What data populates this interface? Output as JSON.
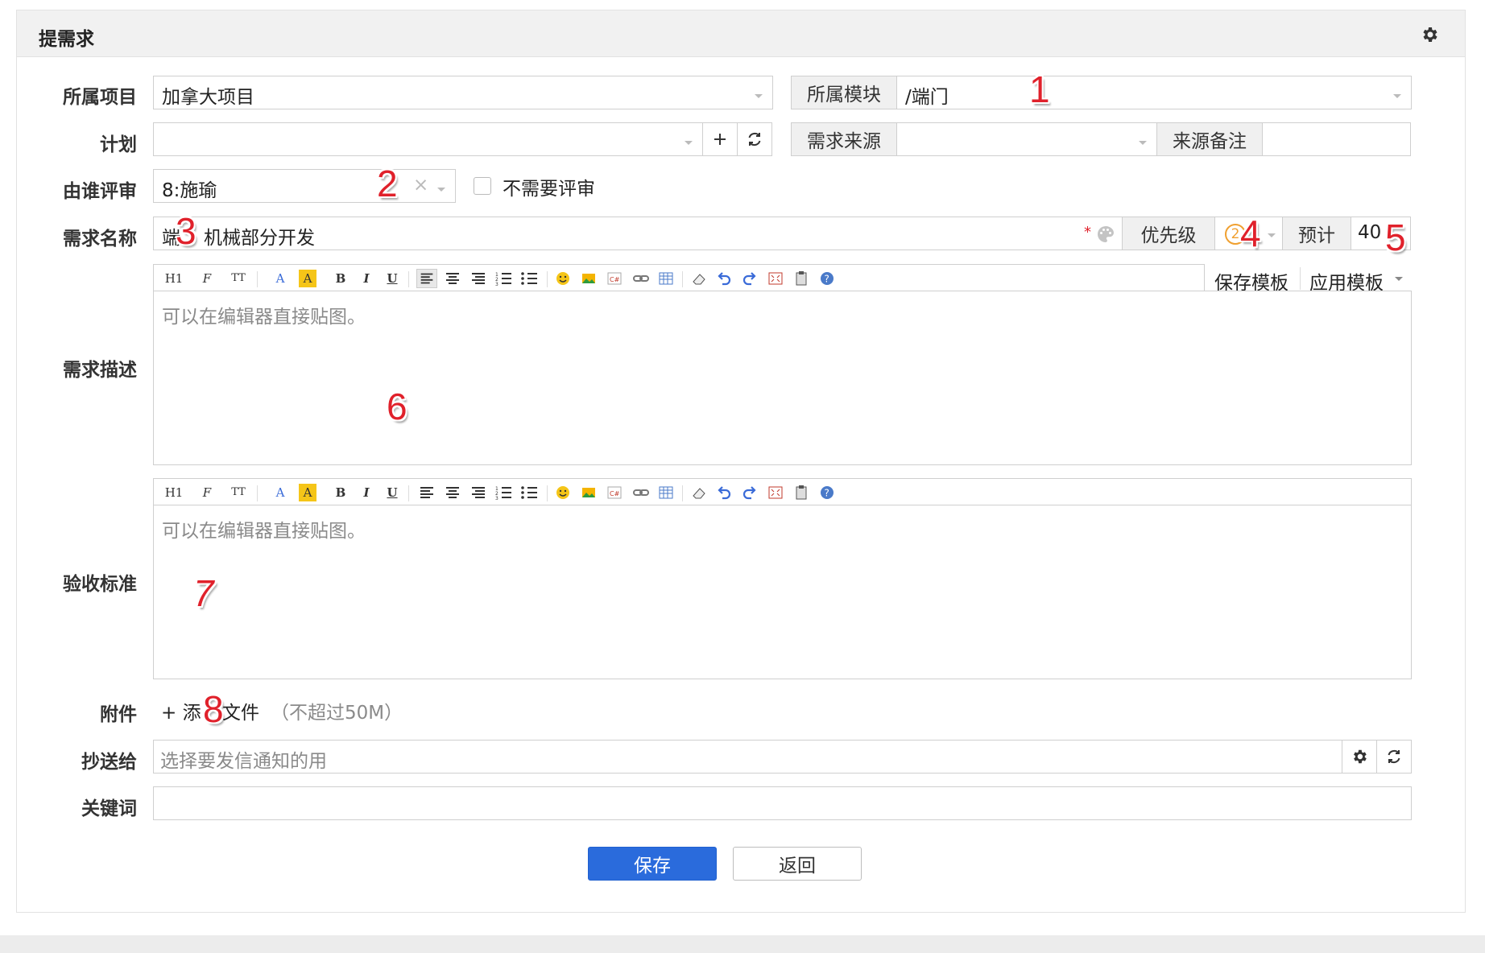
{
  "header": {
    "title": "提需求",
    "settings_icon": "gear-icon"
  },
  "form": {
    "project": {
      "label": "所属项目",
      "value": "加拿大项目"
    },
    "module": {
      "label": "所属模块",
      "value": "/端门"
    },
    "plan": {
      "label": "计划",
      "value": ""
    },
    "source": {
      "label": "需求来源",
      "value": ""
    },
    "source_note": {
      "label": "来源备注",
      "value": ""
    },
    "reviewer": {
      "label": "由谁评审",
      "value": "8:施瑜",
      "no_review_label": "不需要评审"
    },
    "name": {
      "label": "需求名称",
      "value_prefix": "端",
      "value_suffix": "机械部分开发",
      "required_mark": "*"
    },
    "priority": {
      "label": "优先级",
      "value": "2"
    },
    "estimate": {
      "label": "预计",
      "value": "40"
    },
    "description": {
      "label": "需求描述",
      "placeholder": "可以在编辑器直接贴图。",
      "save_template": "保存模板",
      "apply_template": "应用模板"
    },
    "acceptance": {
      "label": "验收标准",
      "placeholder": "可以在编辑器直接贴图。"
    },
    "attachment": {
      "label": "附件",
      "add_prefix": "+ 添",
      "add_suffix": "文件",
      "limit": "（不超过50M）"
    },
    "cc": {
      "label": "抄送给",
      "placeholder": "选择要发信通知的用"
    },
    "keywords": {
      "label": "关键词",
      "value": ""
    }
  },
  "toolbar": [
    "H1",
    "F",
    "TT",
    "A",
    "A",
    "B",
    "I",
    "U"
  ],
  "actions": {
    "save": "保存",
    "back": "返回"
  },
  "markers": [
    "1",
    "2",
    "3",
    "4",
    "5",
    "6",
    "7",
    "8"
  ],
  "colors": {
    "primary": "#2a6bdc",
    "marker": "#e0212b",
    "priority": "#f0a030"
  }
}
